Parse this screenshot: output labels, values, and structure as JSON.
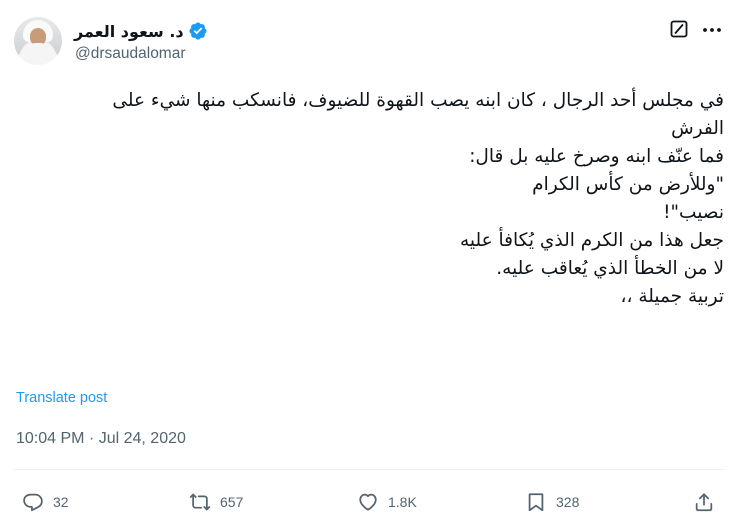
{
  "author": {
    "display_name": "د. سعود العمر",
    "handle": "@drsaudalomar"
  },
  "icons": {
    "verified": "verified-badge-icon",
    "grok": "grok-icon",
    "more": "more-icon",
    "reply": "reply-icon",
    "repost": "repost-icon",
    "like": "like-icon",
    "bookmark": "bookmark-icon",
    "share": "share-icon"
  },
  "colors": {
    "accent": "#1d9bf0",
    "muted": "#536471",
    "text": "#0f1419"
  },
  "post": {
    "lines": [
      "في مجلس أحد الرجال ، كان ابنه يصب القهوة للضيوف، فانسكب منها شيء على",
      "الفرش",
      "",
      "فما عنّف ابنه وصرخ عليه بل قال:",
      "\"وللأرض من كأس الكرام",
      "نصيب\"!",
      "جعل هذا من الكرم الذي يُكافأ عليه",
      "لا من الخطأ الذي يُعاقب عليه.",
      "",
      "تربية جميلة ،،"
    ],
    "translate_label": "Translate post",
    "timestamp": "10:04 PM · Jul 24, 2020"
  },
  "actions": {
    "replies": "32",
    "reposts": "657",
    "likes": "1.8K",
    "bookmarks": "328"
  }
}
